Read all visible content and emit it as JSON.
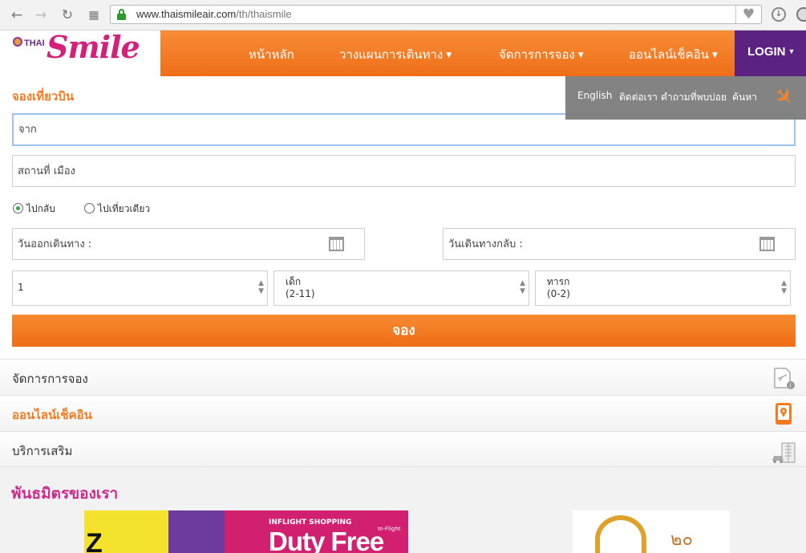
{
  "browser": {
    "url_host": "www.thaismileair.com",
    "url_path": "/th/thaismile",
    "icons": [
      "back-arrow-icon",
      "forward-arrow-icon",
      "reload-icon",
      "apps-grid-icon",
      "lock-icon",
      "heart-icon",
      "download-icon",
      "extension-icon"
    ]
  },
  "header": {
    "logo_thai": "THAI",
    "logo_smile": "Smile",
    "nav": [
      {
        "label": "หน้าหลัก",
        "has_caret": false
      },
      {
        "label": "วางแผนการเดินทาง",
        "has_caret": true
      },
      {
        "label": "จัดการการจอง",
        "has_caret": true
      },
      {
        "label": "ออนไลน์เช็คอิน",
        "has_caret": true
      }
    ],
    "login_label": "LOGIN",
    "colors": {
      "orange": "#f47b20",
      "purple": "#5b2282",
      "pink": "#cc2a8c"
    }
  },
  "util_links": [
    "English",
    "ติดต่อเรา",
    "คำถามที่พบบ่อย",
    "ค้นหา"
  ],
  "booking": {
    "title": "จองเที่ยวบิน",
    "from_placeholder": "จาก",
    "to_placeholder": "สถานที่ เมือง",
    "trip_types": [
      {
        "label": "ไปกลับ",
        "checked": true
      },
      {
        "label": "ไปเที่ยวเดียว",
        "checked": false
      }
    ],
    "depart_placeholder": "วันออกเดินทาง :",
    "return_placeholder": "วันเดินทางกลับ :",
    "adults_value": "1",
    "children_label": "เด็ก",
    "children_range": "(2-11)",
    "infants_label": "ทารก",
    "infants_range": "(0-2)",
    "submit_label": "จอง"
  },
  "accordion": [
    {
      "label": "จัดการการจอง",
      "icon": "boarding-pass-info-icon",
      "highlight": false
    },
    {
      "label": "ออนไลน์เช็คอิน",
      "icon": "mobile-location-icon",
      "highlight": true
    },
    {
      "label": "บริการเสริม",
      "icon": "car-building-icon",
      "highlight": false
    }
  ],
  "partners": {
    "title": "พันธมิตรของเรา",
    "banner1_letter": "Z",
    "banner1_small": "INFLIGHT SHOPPING",
    "banner1_big": "Duty Free",
    "banner1_tag": "In-Flight",
    "banner2_text": "๒๐"
  }
}
